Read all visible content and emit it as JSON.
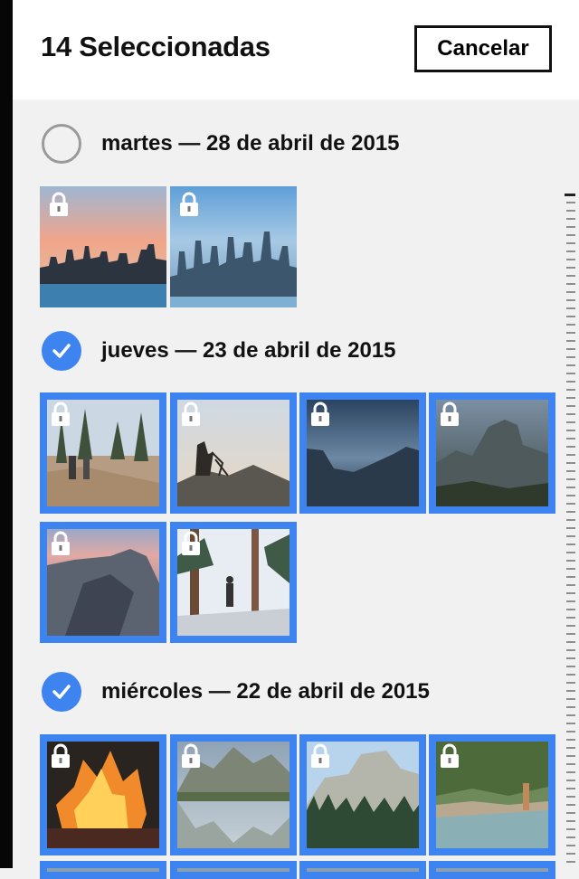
{
  "header": {
    "title": "14 Seleccionadas",
    "cancel_label": "Cancelar"
  },
  "sections": [
    {
      "label": "martes — 28 de abril de 2015",
      "selected": false,
      "photos": [
        {
          "scene": "city-sunset-skyline",
          "locked": true,
          "selected": false
        },
        {
          "scene": "city-blue-skyline",
          "locked": true,
          "selected": false
        }
      ]
    },
    {
      "label": "jueves — 23 de abril de 2015",
      "selected": true,
      "photos": [
        {
          "scene": "forest-hikers",
          "locked": true,
          "selected": true
        },
        {
          "scene": "photographer-on-rock",
          "locked": true,
          "selected": true
        },
        {
          "scene": "valley-dusk",
          "locked": true,
          "selected": true
        },
        {
          "scene": "half-dome-dark",
          "locked": true,
          "selected": true
        },
        {
          "scene": "cliff-sunset",
          "locked": true,
          "selected": true
        },
        {
          "scene": "hiker-in-snowy-forest",
          "locked": true,
          "selected": true
        }
      ]
    },
    {
      "label": "miércoles — 22 de abril de 2015",
      "selected": true,
      "photos": [
        {
          "scene": "campfire",
          "locked": true,
          "selected": true
        },
        {
          "scene": "mountain-reflection",
          "locked": true,
          "selected": true
        },
        {
          "scene": "half-dome-pines",
          "locked": true,
          "selected": true
        },
        {
          "scene": "river-hikers",
          "locked": true,
          "selected": true
        }
      ]
    }
  ],
  "icons": {
    "select_circle": "select-circle-icon",
    "checkmark": "checkmark-icon",
    "lock": "lock-icon"
  },
  "colors": {
    "accent": "#3e84f0",
    "header_bg": "#ffffff",
    "content_bg": "#f1f1f1"
  }
}
